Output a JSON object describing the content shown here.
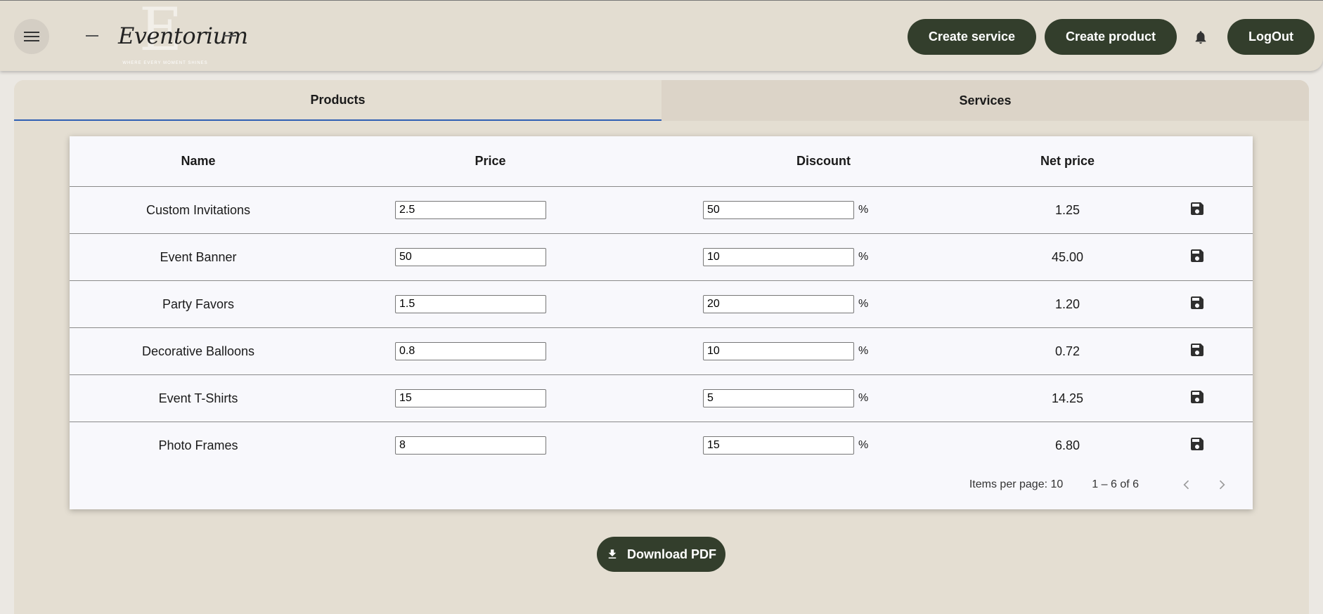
{
  "header": {
    "logo": {
      "letter": "E",
      "name": "Eventorium",
      "tagline": "WHERE EVERY MOMENT SHINES"
    },
    "buttons": {
      "create_service": "Create service",
      "create_product": "Create product",
      "logout": "LogOut"
    }
  },
  "tabs": [
    {
      "label": "Products",
      "active": true
    },
    {
      "label": "Services",
      "active": false
    }
  ],
  "table": {
    "columns": [
      "Name",
      "Price",
      "Discount",
      "Net price"
    ],
    "percent_symbol": "%",
    "rows": [
      {
        "name": "Custom Invitations",
        "price": "2.5",
        "discount": "50",
        "net_price": "1.25"
      },
      {
        "name": "Event Banner",
        "price": "50",
        "discount": "10",
        "net_price": "45.00"
      },
      {
        "name": "Party Favors",
        "price": "1.5",
        "discount": "20",
        "net_price": "1.20"
      },
      {
        "name": "Decorative Balloons",
        "price": "0.8",
        "discount": "10",
        "net_price": "0.72"
      },
      {
        "name": "Event T-Shirts",
        "price": "15",
        "discount": "5",
        "net_price": "14.25"
      },
      {
        "name": "Photo Frames",
        "price": "8",
        "discount": "15",
        "net_price": "6.80"
      }
    ]
  },
  "paginator": {
    "items_per_page_label": "Items per page: 10",
    "range_label": "1 – 6 of 6"
  },
  "download_label": "Download PDF",
  "colors": {
    "accent_dark": "#333e2c",
    "header_bg": "#e3ddd1",
    "tab_indicator": "#2f5fb3"
  }
}
